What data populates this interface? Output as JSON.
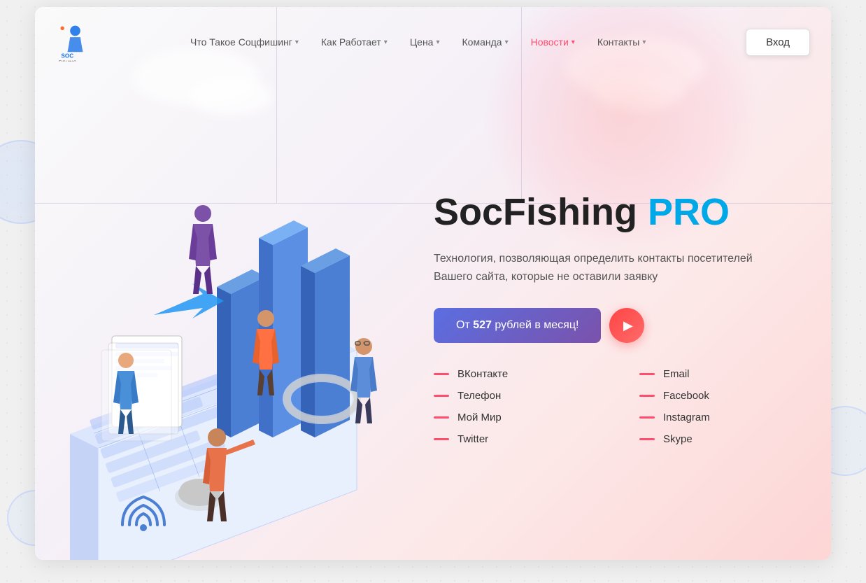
{
  "site": {
    "name": "SocFishing",
    "logo_text": "SOC FISHING"
  },
  "navbar": {
    "items": [
      {
        "label": "Что Такое Соцфишинг",
        "has_dropdown": true,
        "active": false
      },
      {
        "label": "Как Работает",
        "has_dropdown": true,
        "active": false
      },
      {
        "label": "Цена",
        "has_dropdown": true,
        "active": false
      },
      {
        "label": "Команда",
        "has_dropdown": true,
        "active": false
      },
      {
        "label": "Новости",
        "has_dropdown": true,
        "active": true
      },
      {
        "label": "Контакты",
        "has_dropdown": true,
        "active": false
      }
    ],
    "login_label": "Вход"
  },
  "hero": {
    "title_main": "SocFishing ",
    "title_pro": "PRO",
    "description": "Технология, позволяющая определить контакты посетителей Вашего сайта, которые не оставили заявку",
    "cta_prefix": "От ",
    "cta_price": "527",
    "cta_suffix": " рублей в месяц!"
  },
  "contacts": {
    "left": [
      {
        "label": "ВКонтакте"
      },
      {
        "label": "Телефон"
      },
      {
        "label": "Мой Мир"
      },
      {
        "label": "Twitter"
      }
    ],
    "right": [
      {
        "label": "Email"
      },
      {
        "label": "Facebook"
      },
      {
        "label": "Instagram"
      },
      {
        "label": "Skype"
      }
    ]
  },
  "colors": {
    "accent_blue": "#00a8e8",
    "accent_red": "#ff4d6d",
    "nav_active": "#ff4d6d",
    "cta_gradient_start": "#5b6ee1",
    "cta_gradient_end": "#7b52ab"
  }
}
